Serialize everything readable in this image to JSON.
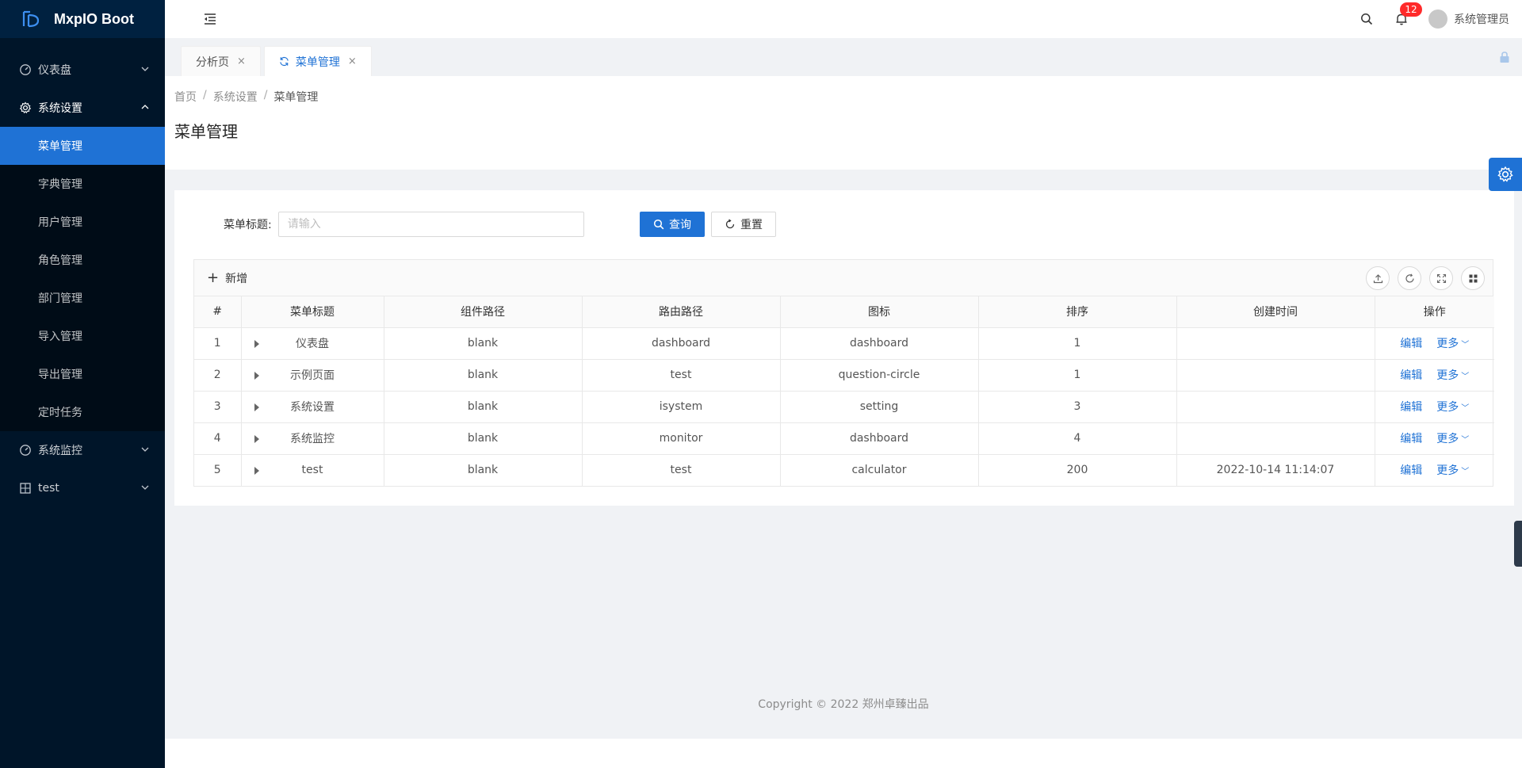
{
  "app": {
    "name": "MxpIO Boot"
  },
  "sidebar": {
    "menu": [
      {
        "label": "仪表盘"
      },
      {
        "label": "系统设置"
      },
      {
        "label": "系统监控"
      },
      {
        "label": "test"
      }
    ],
    "submenu": [
      {
        "label": "菜单管理"
      },
      {
        "label": "字典管理"
      },
      {
        "label": "用户管理"
      },
      {
        "label": "角色管理"
      },
      {
        "label": "部门管理"
      },
      {
        "label": "导入管理"
      },
      {
        "label": "导出管理"
      },
      {
        "label": "定时任务"
      }
    ]
  },
  "header": {
    "notification_count": "12",
    "username": "系统管理员"
  },
  "tabs": [
    {
      "label": "分析页",
      "close": "×"
    },
    {
      "label": "菜单管理",
      "close": "×"
    }
  ],
  "breadcrumb": {
    "items": [
      "首页",
      "系统设置",
      "菜单管理"
    ],
    "separator": "/"
  },
  "page": {
    "title": "菜单管理"
  },
  "search": {
    "label": "菜单标题:",
    "placeholder": "请输入",
    "value": "",
    "query_label": "查询",
    "reset_label": "重置"
  },
  "toolbar": {
    "add_label": "新增"
  },
  "table": {
    "columns": [
      "#",
      "菜单标题",
      "组件路径",
      "路由路径",
      "图标",
      "排序",
      "创建时间",
      "操作"
    ],
    "rows": [
      {
        "no": "1",
        "title": "仪表盘",
        "component": "blank",
        "route": "dashboard",
        "icon": "dashboard",
        "order": "1",
        "created": ""
      },
      {
        "no": "2",
        "title": "示例页面",
        "component": "blank",
        "route": "test",
        "icon": "question-circle",
        "order": "1",
        "created": ""
      },
      {
        "no": "3",
        "title": "系统设置",
        "component": "blank",
        "route": "isystem",
        "icon": "setting",
        "order": "3",
        "created": ""
      },
      {
        "no": "4",
        "title": "系统监控",
        "component": "blank",
        "route": "monitor",
        "icon": "dashboard",
        "order": "4",
        "created": ""
      },
      {
        "no": "5",
        "title": "test",
        "component": "blank",
        "route": "test",
        "icon": "calculator",
        "order": "200",
        "created": "2022-10-14 11:14:07"
      }
    ],
    "edit_label": "编辑",
    "more_label": "更多"
  },
  "footer": {
    "copyright": "Copyright © 2022 郑州卓臻出品"
  },
  "colors": {
    "primary": "#1f72d5",
    "sidebar": "#001529",
    "submenu": "#000c17",
    "badge": "#ff2a2a"
  }
}
